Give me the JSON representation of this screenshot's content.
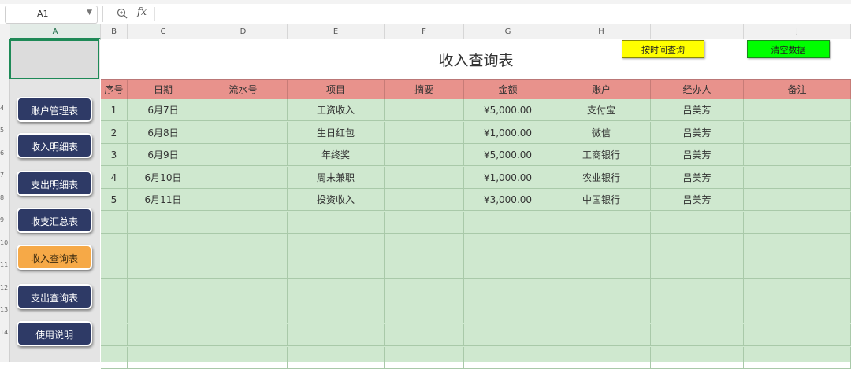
{
  "formula_bar": {
    "name_box": "A1",
    "fx_label": "fx",
    "zoom_icon": "zoom-in-icon"
  },
  "columns": [
    "A",
    "B",
    "C",
    "D",
    "E",
    "F",
    "G",
    "H",
    "I",
    "J"
  ],
  "rows": [
    "4",
    "5",
    "6",
    "7",
    "8",
    "9",
    "10",
    "11",
    "12",
    "13",
    "14"
  ],
  "nav": {
    "items": [
      "账户管理表",
      "收入明细表",
      "支出明细表",
      "收支汇总表",
      "收入查询表",
      "支出查询表",
      "使用说明"
    ],
    "active_index": 4
  },
  "sheet": {
    "title": "收入查询表",
    "query_button": "按时间查询",
    "clear_button": "清空数据",
    "headers": [
      "序号",
      "日期",
      "流水号",
      "项目",
      "摘要",
      "金额",
      "账户",
      "经办人",
      "备注"
    ],
    "records": [
      [
        "1",
        "6月7日",
        "",
        "工资收入",
        "",
        "¥5,000.00",
        "支付宝",
        "吕美芳",
        ""
      ],
      [
        "2",
        "6月8日",
        "",
        "生日红包",
        "",
        "¥1,000.00",
        "微信",
        "吕美芳",
        ""
      ],
      [
        "3",
        "6月9日",
        "",
        "年终奖",
        "",
        "¥5,000.00",
        "工商银行",
        "吕美芳",
        ""
      ],
      [
        "4",
        "6月10日",
        "",
        "周末兼职",
        "",
        "¥1,000.00",
        "农业银行",
        "吕美芳",
        ""
      ],
      [
        "5",
        "6月11日",
        "",
        "投资收入",
        "",
        "¥3,000.00",
        "中国银行",
        "吕美芳",
        ""
      ]
    ],
    "empty_rows": 7
  },
  "colors": {
    "nav_button": "#2e3a66",
    "nav_active": "#f6a947",
    "header_fill": "#e8928c",
    "body_fill": "#cfe8cf",
    "query_button": "#ffff00",
    "clear_button": "#00ff00",
    "selection": "#1e8a57"
  }
}
